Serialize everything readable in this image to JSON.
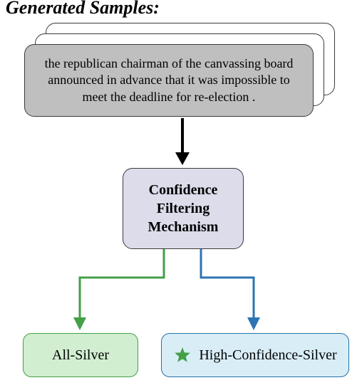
{
  "header": {
    "title_fragment": "Generated Samples:"
  },
  "sample": {
    "text": "the republican chairman of the canvassing board announced in advance that it was impossible to meet the deadline for re-election ."
  },
  "filter_box": {
    "label": "Confidence\nFiltering\nMechanism"
  },
  "outputs": {
    "all_silver": {
      "label": "All-Silver"
    },
    "high_conf": {
      "label": "High-Confidence-Silver"
    }
  },
  "colors": {
    "arrow_black": "#000000",
    "arrow_green": "#43a047",
    "arrow_blue": "#2c74b3",
    "star_fill": "#43a047"
  }
}
